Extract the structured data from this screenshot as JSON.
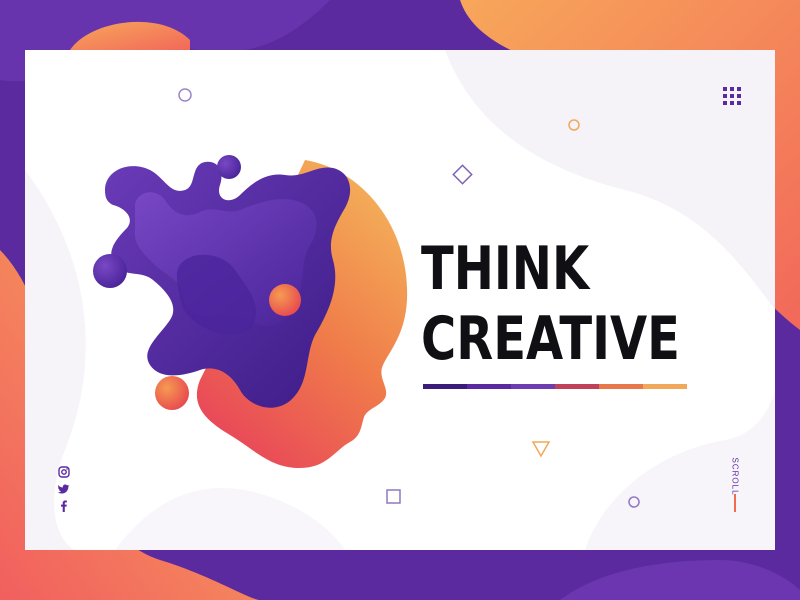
{
  "hero": {
    "title_line1": "THINK",
    "title_line2": "CREATIVE"
  },
  "scroll": {
    "label": "SCROLL"
  },
  "social": {
    "items": [
      "instagram-icon",
      "twitter-icon",
      "facebook-icon"
    ]
  },
  "menu": {
    "icon": "grid-menu-icon"
  },
  "colors": {
    "purple": "#5b2aa0",
    "orange": "#f6a45a",
    "coral": "#f06c4c",
    "text": "#0f0f14",
    "bar": [
      "#3a1d7a",
      "#5b2aa0",
      "#6e3db0",
      "#c0425a",
      "#e8774b",
      "#f2a85a"
    ]
  }
}
